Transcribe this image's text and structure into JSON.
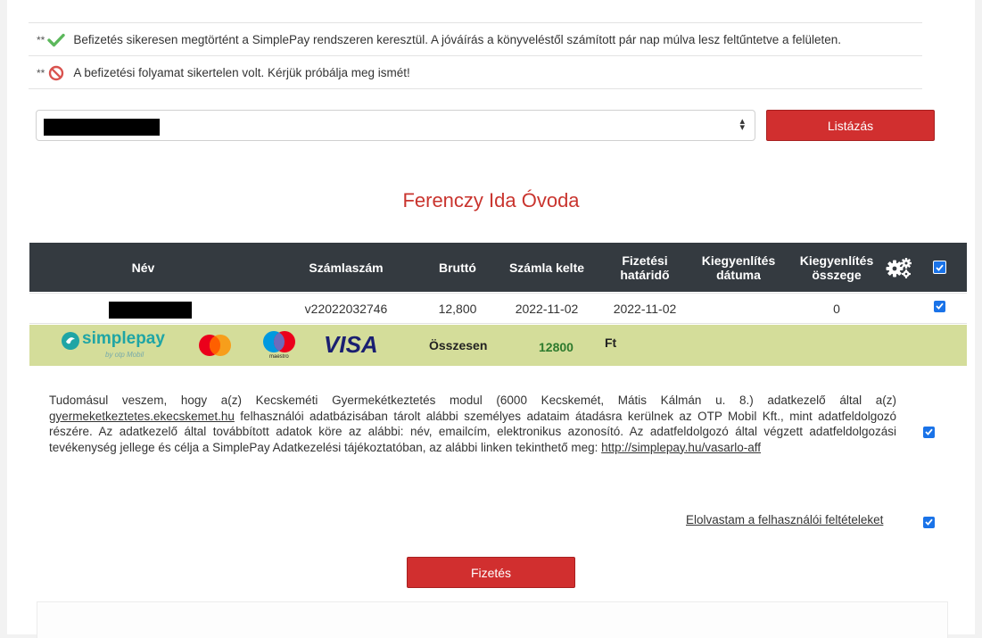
{
  "notices": [
    {
      "stars": "**",
      "icon": "checkmark-icon",
      "text": "Befizetés sikeresen megtörtént a SimplePay rendszeren keresztül. A jóváírás a könyveléstől számított pár nap múlva lesz feltűntetve a felületen."
    },
    {
      "stars": "**",
      "icon": "prohibited-icon",
      "text": "A befizetési folyamat sikertelen volt. Kérjük próbálja meg ismét!"
    }
  ],
  "selector": {
    "value_redacted": true
  },
  "buttons": {
    "list": "Listázás",
    "pay": "Fizetés"
  },
  "title": "Ferenczy Ida Óvoda",
  "table": {
    "headers": {
      "name": "Név",
      "invoice_no": "Számlaszám",
      "gross": "Bruttó",
      "invoice_date": "Számla kelte",
      "due_1": "Fizetési",
      "due_2": "határidő",
      "settle_date_1": "Kiegyenlítés",
      "settle_date_2": "dátuma",
      "settle_amount_1": "Kiegyenlítés",
      "settle_amount_2": "összege"
    },
    "rows": [
      {
        "invoice_no": "v22022032746",
        "gross": "12,800",
        "invoice_date": "2022-11-02",
        "due_date": "2022-11-02",
        "settle_date": "",
        "settle_amount": "0",
        "checked": true
      }
    ]
  },
  "payment": {
    "brand": "simplepay",
    "brand_sub": "by otp Mobil",
    "maestro": "maestro",
    "visa": "VISA",
    "total_label": "Összesen",
    "total_value": "12800",
    "currency": "Ft"
  },
  "consent": {
    "p1": "Tudomásul veszem, hogy a(z) Kecskeméti Gyermekétkeztetés modul (6000 Kecskemét, Mátis Kálmán u. 8.) adatkezelő által a(z) ",
    "link1": "gyermeketkeztetes.ekecskemet.hu",
    "p2": " felhasználói adatbázisában tárolt alábbi személyes adataim átadásra kerülnek az OTP Mobil Kft., mint adatfeldolgozó részére. Az adatkezelő által továbbított adatok köre az alábbi: név, emailcím, elektronikus azonosító. Az adatfeldolgozó által végzett adatfeldolgozási tevékenység jellege és célja a SimplePay Adatkezelési tájékoztatóban, az alábbi linken tekinthető meg: ",
    "link2": "http://simplepay.hu/vasarlo-aff"
  },
  "terms_link": "Elolvastam a felhasználói feltételeket",
  "colors": {
    "accent_red": "#d12f2f",
    "title_red": "#c9342e",
    "header_dark": "#343a40",
    "pay_row_green": "#d4dd9a",
    "checkbox_blue": "#1a73e8"
  }
}
